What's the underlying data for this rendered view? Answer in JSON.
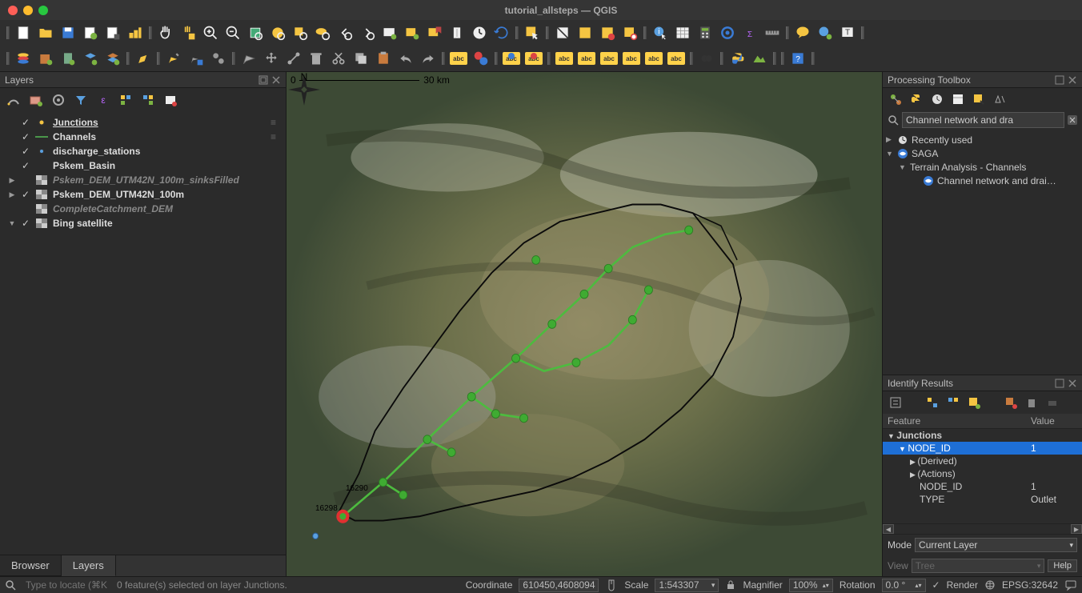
{
  "window": {
    "title": "tutorial_allsteps — QGIS"
  },
  "panels": {
    "layers": {
      "title": "Layers"
    },
    "processing": {
      "title": "Processing Toolbox",
      "search_value": "Channel network and dra"
    },
    "identify": {
      "title": "Identify Results"
    }
  },
  "tabs": {
    "browser": "Browser",
    "layers": "Layers"
  },
  "layers": [
    {
      "arrow": "",
      "checked": true,
      "sym": "dot-yellow",
      "name": "Junctions",
      "italic": false,
      "underline": true,
      "menu": true
    },
    {
      "arrow": "",
      "checked": true,
      "sym": "line-green",
      "name": "Channels",
      "italic": false,
      "menu": true
    },
    {
      "arrow": "",
      "checked": true,
      "sym": "dot-blue",
      "name": "discharge_stations",
      "italic": false
    },
    {
      "arrow": "",
      "checked": true,
      "sym": "none",
      "name": "Pskem_Basin",
      "italic": false
    },
    {
      "arrow": "▶",
      "checked": false,
      "sym": "raster",
      "name": "Pskem_DEM_UTM42N_100m_sinksFilled",
      "italic": true
    },
    {
      "arrow": "▶",
      "checked": true,
      "sym": "raster",
      "name": "Pskem_DEM_UTM42N_100m",
      "italic": false
    },
    {
      "arrow": "",
      "checked": false,
      "sym": "raster",
      "name": "CompleteCatchment_DEM",
      "italic": true
    },
    {
      "arrow": "▼",
      "checked": true,
      "sym": "raster",
      "name": "Bing satellite",
      "italic": false
    }
  ],
  "toolbox": {
    "recently_used": "Recently used",
    "saga": "SAGA",
    "terrain": "Terrain Analysis - Channels",
    "algorithm": "Channel network and drai…"
  },
  "identify_table": {
    "headers": {
      "feature": "Feature",
      "value": "Value"
    },
    "rows": [
      {
        "indent": 0,
        "arrow": "▼",
        "label": "Junctions",
        "value": "",
        "bold": true
      },
      {
        "indent": 1,
        "arrow": "▼",
        "label": "NODE_ID",
        "value": "1",
        "selected": true
      },
      {
        "indent": 2,
        "arrow": "▶",
        "label": "(Derived)",
        "value": ""
      },
      {
        "indent": 2,
        "arrow": "▶",
        "label": "(Actions)",
        "value": ""
      },
      {
        "indent": 2,
        "arrow": "",
        "label": "NODE_ID",
        "value": "1"
      },
      {
        "indent": 2,
        "arrow": "",
        "label": "TYPE",
        "value": "Outlet"
      }
    ],
    "mode_label": "Mode",
    "mode_value": "Current Layer",
    "view_label": "View",
    "view_value": "Tree",
    "help": "Help"
  },
  "statusbar": {
    "locator_placeholder": "Type to locate (⌘K)",
    "message": "0 feature(s) selected on layer Junctions.",
    "coordinate_label": "Coordinate",
    "coordinate_value": "610450,4608094",
    "scale_label": "Scale",
    "scale_value": "1:543307",
    "magnifier_label": "Magnifier",
    "magnifier_value": "100%",
    "rotation_label": "Rotation",
    "rotation_value": "0.0 °",
    "render_label": "Render",
    "crs": "EPSG:32642"
  },
  "map": {
    "scale_text_0": "0",
    "scale_text_30": "30 km",
    "feature_label_1": "16290",
    "feature_label_2": "16298"
  }
}
